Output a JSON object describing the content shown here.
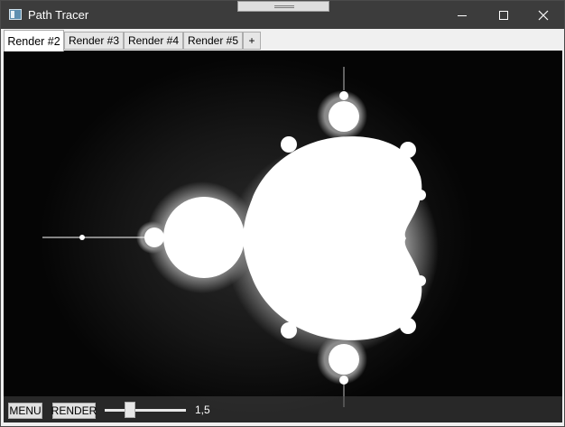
{
  "window": {
    "title": "Path Tracer"
  },
  "tabs": [
    {
      "label": "Render #2",
      "active": true
    },
    {
      "label": "Render #3",
      "active": false
    },
    {
      "label": "Render #4",
      "active": false
    },
    {
      "label": "Render #5",
      "active": false
    },
    {
      "label": "+",
      "active": false
    }
  ],
  "toolbar": {
    "menu_label": "MENU",
    "render_label": "RENDER",
    "slider_value_text": "1,5",
    "slider_fraction": 0.28
  },
  "icons": {
    "app": "app-window-icon",
    "minimize": "minimize-icon",
    "maximize": "maximize-icon",
    "close": "close-icon"
  },
  "colors": {
    "titlebar": "#3c3c3c",
    "canvas_background": "#050505",
    "fractal": "#ffffff"
  }
}
